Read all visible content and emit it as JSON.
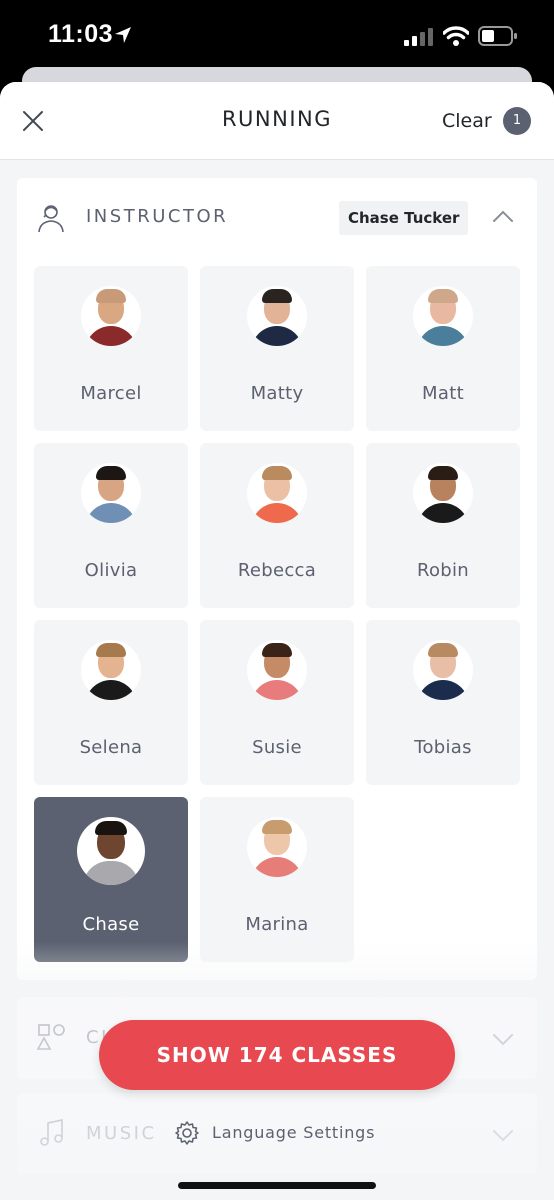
{
  "status_bar": {
    "time": "11:03"
  },
  "header": {
    "title": "RUNNING",
    "clear_label": "Clear",
    "filter_count": "1"
  },
  "instructor_section": {
    "label": "INSTRUCTOR",
    "selected_value": "Chase Tucker",
    "instructors": [
      {
        "name": "Marcel",
        "skin": "#d9a883",
        "hair": "#c99a78",
        "shirt": "#8b2a2a"
      },
      {
        "name": "Matty",
        "skin": "#e2b396",
        "hair": "#2a2420",
        "shirt": "#1e2a44"
      },
      {
        "name": "Matt",
        "skin": "#e8b9a0",
        "hair": "#cfa88b",
        "shirt": "#4b7e9a"
      },
      {
        "name": "Olivia",
        "skin": "#d8a584",
        "hair": "#1c1714",
        "shirt": "#6f8fb5"
      },
      {
        "name": "Rebecca",
        "skin": "#ecc0a4",
        "hair": "#b98b5f",
        "shirt": "#ef6a4c"
      },
      {
        "name": "Robin",
        "skin": "#b9825e",
        "hair": "#2a1d16",
        "shirt": "#1a1a1a"
      },
      {
        "name": "Selena",
        "skin": "#e4b38f",
        "hair": "#a77a4e",
        "shirt": "#1a1a1a"
      },
      {
        "name": "Susie",
        "skin": "#c58a66",
        "hair": "#3a2418",
        "shirt": "#e87c7c"
      },
      {
        "name": "Tobias",
        "skin": "#e8bfa6",
        "hair": "#b88a62",
        "shirt": "#1c2c4c"
      },
      {
        "name": "Chase",
        "skin": "#6e4630",
        "hair": "#1a1410",
        "shirt": "#a9a9ad",
        "selected": true
      },
      {
        "name": "Marina",
        "skin": "#eec6aa",
        "hair": "#c99c70",
        "shirt": "#e67d78"
      }
    ]
  },
  "class_type_section": {
    "label": "CLASS TYPE"
  },
  "music_section": {
    "label": "MUSIC"
  },
  "show_button": {
    "label": "SHOW 174 CLASSES"
  },
  "language_settings": {
    "label": "Language Settings"
  },
  "colors": {
    "accent": "#e8484f",
    "selected_tile": "#5b6170",
    "text_muted": "#5b6170"
  }
}
